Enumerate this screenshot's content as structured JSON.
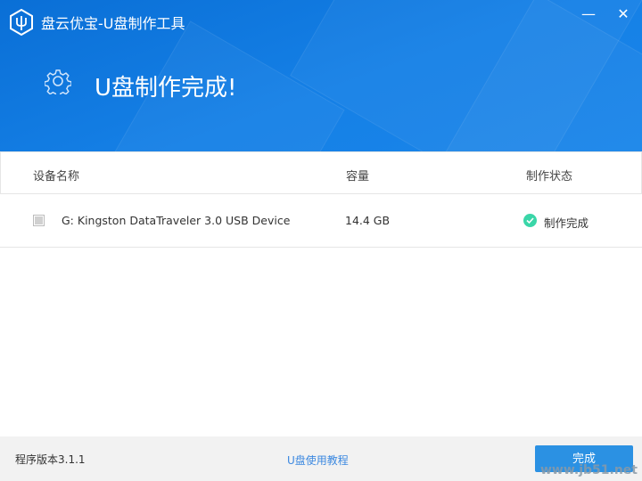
{
  "window": {
    "title": "盘云优宝-U盘制作工具",
    "minimize_label": "—",
    "close_label": "✕"
  },
  "banner": {
    "title": "U盘制作完成!"
  },
  "table": {
    "headers": {
      "name": "设备名称",
      "capacity": "容量",
      "status": "制作状态"
    },
    "rows": [
      {
        "name": "G: Kingston DataTraveler 3.0 USB Device",
        "capacity": "14.4 GB",
        "status": "制作完成"
      }
    ]
  },
  "footer": {
    "version": "程序版本3.1.1",
    "tutorial_link": "U盘使用教程",
    "done_button": "完成"
  },
  "watermark": "www.jb51.net",
  "colors": {
    "header": "#1580e6",
    "button": "#2b91e3",
    "success": "#3ad6a8",
    "link": "#3b88e0"
  }
}
